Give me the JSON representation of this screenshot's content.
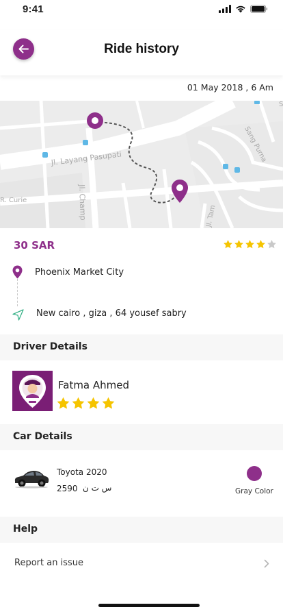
{
  "status_bar": {
    "time": "9:41"
  },
  "header": {
    "title": "Ride history"
  },
  "ride": {
    "date": "01 May 2018 , 6 Am",
    "fare": "30 SAR",
    "rating": 4,
    "rating_max": 5,
    "pickup": "Phoenix Market City",
    "dropoff": "New cairo , giza , 64 yousef sabry"
  },
  "map": {
    "labels": [
      "Jl. Layang Pasupati",
      "Jl. Champ",
      "Sang Purna",
      "Jl. Tam",
      "R. Curie"
    ]
  },
  "driver_section": {
    "title": "Driver Details",
    "name": "Fatma Ahmed",
    "rating": 4
  },
  "car_section": {
    "title": "Car Details",
    "model": "Toyota 2020",
    "plate_number": "2590",
    "plate_letters": "س ت ن",
    "color_label": "Gray Color",
    "color_swatch": "#8e2f8a"
  },
  "help_section": {
    "title": "Help",
    "report_label": "Report an issue"
  },
  "colors": {
    "brand": "#8e2f8a",
    "star": "#f5c400"
  }
}
